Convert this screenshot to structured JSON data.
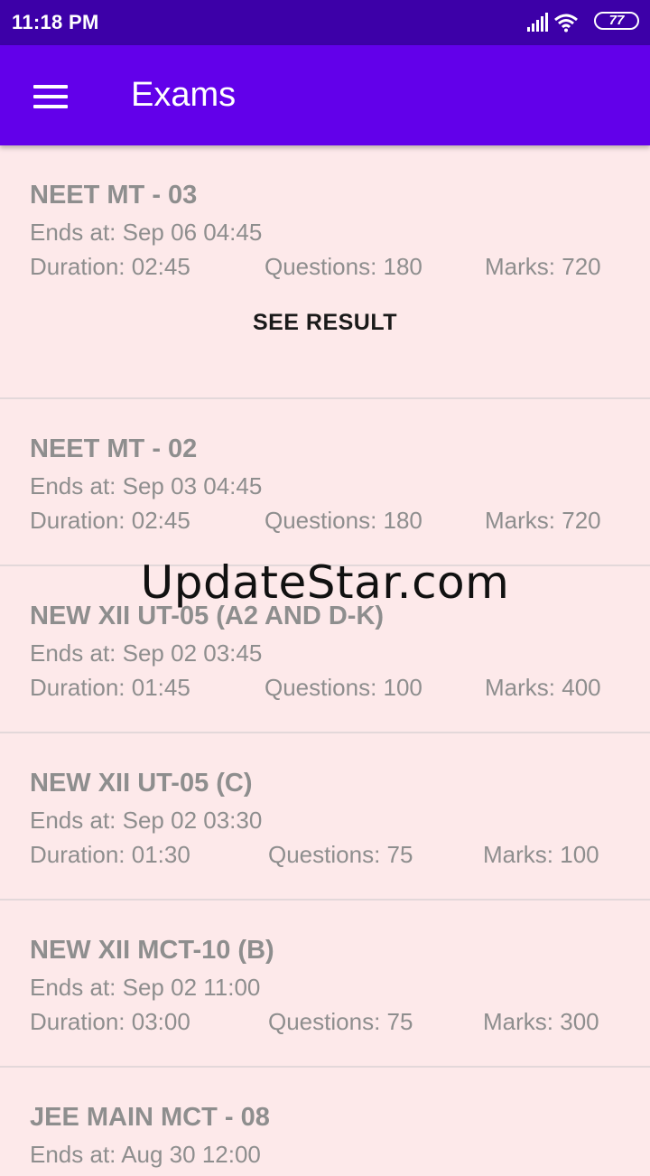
{
  "status_bar": {
    "time": "11:18 PM",
    "battery": "77",
    "icons": [
      "signal-icon",
      "wifi-icon",
      "battery-icon"
    ]
  },
  "app_bar": {
    "title": "Exams",
    "menu_icon": "menu-icon"
  },
  "labels": {
    "ends_prefix": "Ends at: ",
    "duration_prefix": "Duration: ",
    "questions_prefix": "Questions: ",
    "marks_prefix": "Marks: "
  },
  "exams": [
    {
      "title": "NEET MT - 03",
      "ends_at": "Sep 06 04:45",
      "duration": "02:45",
      "questions": "180",
      "marks": "720",
      "action": "SEE RESULT"
    },
    {
      "title": "NEET MT - 02",
      "ends_at": "Sep 03 04:45",
      "duration": "02:45",
      "questions": "180",
      "marks": "720"
    },
    {
      "title": "NEW XII UT-05 (A2 AND D-K)",
      "ends_at": "Sep 02 03:45",
      "duration": "01:45",
      "questions": "100",
      "marks": "400"
    },
    {
      "title": "NEW XII UT-05 (C)",
      "ends_at": "Sep 02 03:30",
      "duration": "01:30",
      "questions": "75",
      "marks": "100"
    },
    {
      "title": "NEW XII MCT-10 (B)",
      "ends_at": "Sep 02 11:00",
      "duration": "03:00",
      "questions": "75",
      "marks": "300"
    },
    {
      "title": "JEE MAIN MCT - 08",
      "ends_at": "Aug 30 12:00"
    }
  ],
  "watermark": "UpdateStar.com",
  "colors": {
    "status_bar": "#3d00a8",
    "app_bar": "#6200ea",
    "background": "#fde9ea",
    "text_muted": "#8e8e8e"
  }
}
